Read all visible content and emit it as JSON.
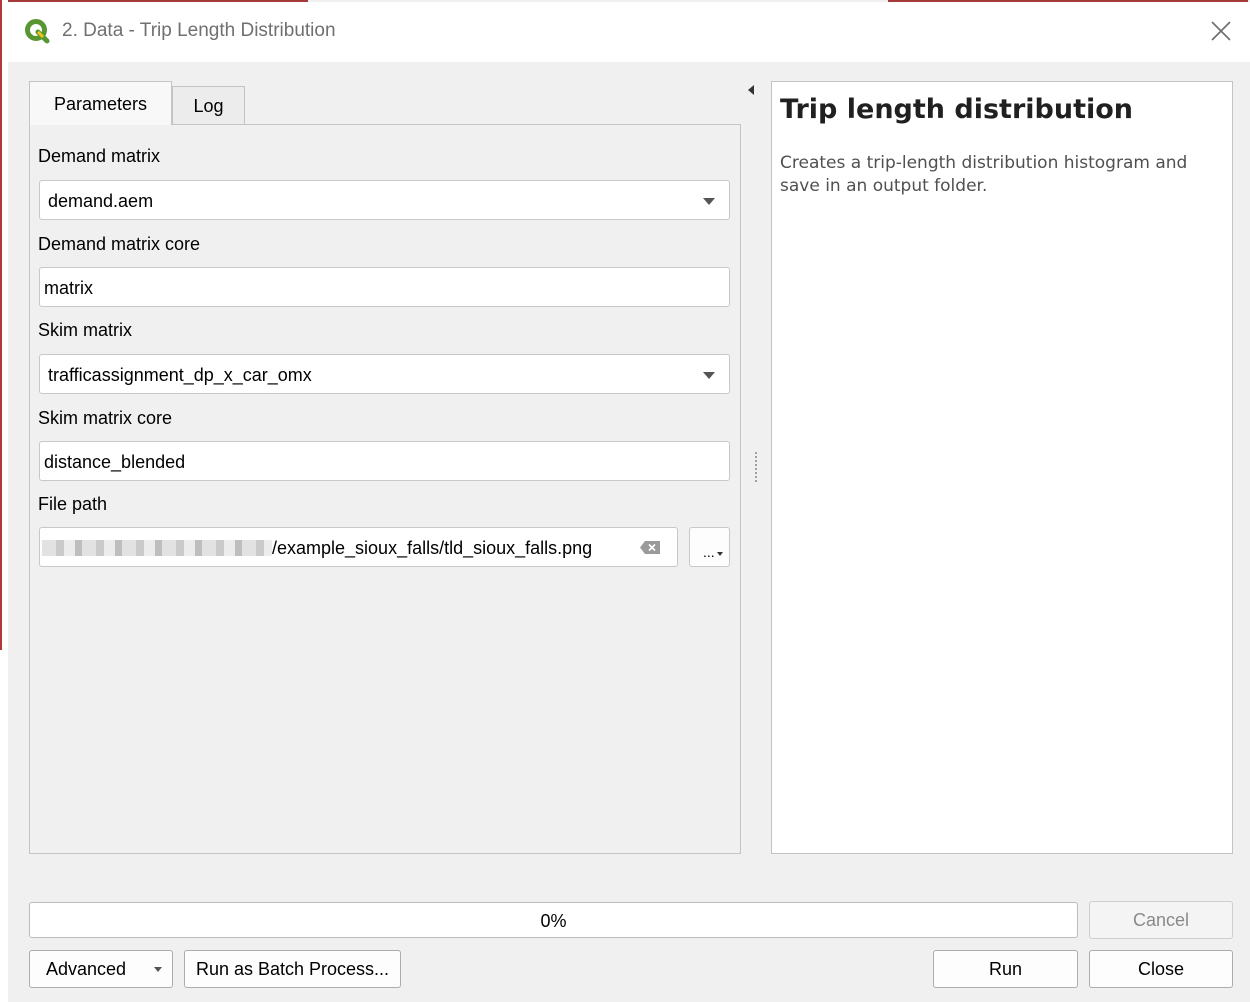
{
  "window": {
    "title": "2. Data - Trip Length Distribution",
    "app_icon": "qgis-logo-icon"
  },
  "tabs": [
    {
      "label": "Parameters",
      "active": true
    },
    {
      "label": "Log",
      "active": false
    }
  ],
  "params": {
    "demand_matrix": {
      "label": "Demand matrix",
      "value": "demand.aem"
    },
    "demand_core": {
      "label": "Demand matrix core",
      "value": "matrix"
    },
    "skim_matrix": {
      "label": "Skim matrix",
      "value": "trafficassignment_dp_x_car_omx"
    },
    "skim_core": {
      "label": "Skim matrix core",
      "value": "distance_blended"
    },
    "file_path": {
      "label": "File path",
      "value": "/example_sioux_falls/tld_sioux_falls.png",
      "browse_label": "..."
    }
  },
  "help": {
    "title": "Trip length distribution",
    "description": "Creates a trip-length distribution histogram and save in an output folder."
  },
  "progress": {
    "text": "0%",
    "value": 0
  },
  "buttons": {
    "cancel": "Cancel",
    "advanced": "Advanced",
    "batch": "Run as Batch Process...",
    "run": "Run",
    "close": "Close"
  },
  "colors": {
    "accent": "#06b025",
    "qgis_green": "#589632",
    "qgis_yellow": "#ee7913"
  }
}
